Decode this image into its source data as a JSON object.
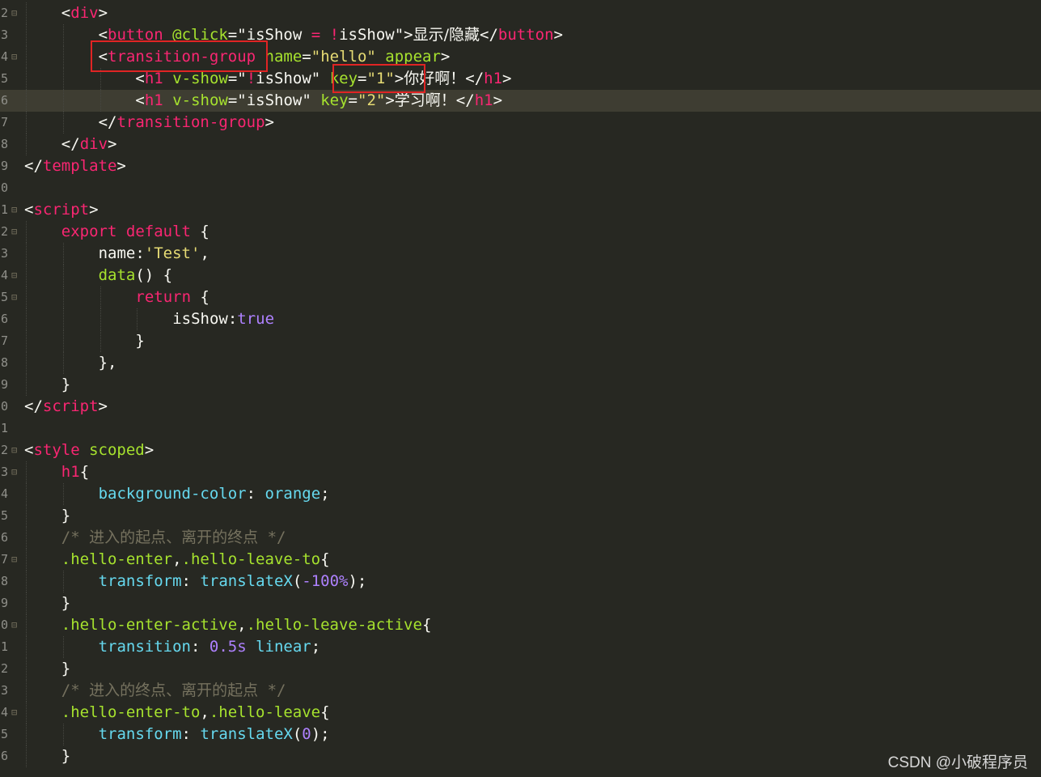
{
  "editor": {
    "theme_colors": {
      "background": "#272822",
      "current_line": "#3e3d32",
      "tag": "#f92672",
      "attribute": "#a6e22e",
      "string": "#e6db74",
      "property": "#66d9ef",
      "number": "#ae81ff",
      "comment": "#75715e",
      "highlight_box": "#e02424"
    },
    "lines": [
      {
        "num": "2",
        "fold": "⊟",
        "indent": 2,
        "tokens": [
          [
            "plain",
            "<"
          ],
          [
            "tag",
            "div"
          ],
          [
            "plain",
            ">"
          ]
        ]
      },
      {
        "num": "3",
        "fold": "",
        "indent": 4,
        "tokens": [
          [
            "plain",
            "<"
          ],
          [
            "tag",
            "button"
          ],
          [
            "plain",
            " "
          ],
          [
            "attr",
            "@click"
          ],
          [
            "plain",
            "=\"isShow "
          ],
          [
            "kw",
            "="
          ],
          [
            "plain",
            " "
          ],
          [
            "kw",
            "!"
          ],
          [
            "plain",
            "isShow\">"
          ],
          [
            "cjk",
            "显示/隐藏"
          ],
          [
            "plain",
            "</"
          ],
          [
            "tag",
            "button"
          ],
          [
            "plain",
            ">"
          ]
        ]
      },
      {
        "num": "4",
        "fold": "⊟",
        "indent": 4,
        "tokens": [
          [
            "plain",
            "<"
          ],
          [
            "tag",
            "transition-group"
          ],
          [
            "plain",
            " "
          ],
          [
            "attr",
            "name"
          ],
          [
            "plain",
            "="
          ],
          [
            "str",
            "\"hello\""
          ],
          [
            "plain",
            " "
          ],
          [
            "attr",
            "appear"
          ],
          [
            "plain",
            ">"
          ]
        ]
      },
      {
        "num": "5",
        "fold": "",
        "indent": 6,
        "tokens": [
          [
            "plain",
            "<"
          ],
          [
            "tag",
            "h1"
          ],
          [
            "plain",
            " "
          ],
          [
            "attr",
            "v-show"
          ],
          [
            "plain",
            "=\""
          ],
          [
            "kw",
            "!"
          ],
          [
            "plain",
            "isShow\" "
          ],
          [
            "attr",
            "key"
          ],
          [
            "plain",
            "="
          ],
          [
            "str",
            "\"1\""
          ],
          [
            "plain",
            ">"
          ],
          [
            "cjk",
            "你好啊！"
          ],
          [
            "plain",
            "</"
          ],
          [
            "tag",
            "h1"
          ],
          [
            "plain",
            ">"
          ]
        ]
      },
      {
        "num": "6",
        "fold": "",
        "indent": 6,
        "current": true,
        "tokens": [
          [
            "plain",
            "<"
          ],
          [
            "tag",
            "h1"
          ],
          [
            "plain",
            " "
          ],
          [
            "attr",
            "v-show"
          ],
          [
            "plain",
            "=\"isShow\" "
          ],
          [
            "attr",
            "key"
          ],
          [
            "plain",
            "="
          ],
          [
            "str",
            "\"2\""
          ],
          [
            "plain",
            ">"
          ],
          [
            "cjk",
            "学习啊！"
          ],
          [
            "plain",
            "</"
          ],
          [
            "tag",
            "h1"
          ],
          [
            "plain",
            ">"
          ]
        ]
      },
      {
        "num": "7",
        "fold": "",
        "indent": 4,
        "tokens": [
          [
            "plain",
            "</"
          ],
          [
            "tag",
            "transition-group"
          ],
          [
            "plain",
            ">"
          ]
        ]
      },
      {
        "num": "8",
        "fold": "",
        "indent": 2,
        "tokens": [
          [
            "plain",
            "</"
          ],
          [
            "tag",
            "div"
          ],
          [
            "plain",
            ">"
          ]
        ]
      },
      {
        "num": "9",
        "fold": "",
        "indent": 0,
        "tokens": [
          [
            "plain",
            "</"
          ],
          [
            "tag",
            "template"
          ],
          [
            "plain",
            ">"
          ]
        ]
      },
      {
        "num": "0",
        "fold": "",
        "indent": 0,
        "tokens": []
      },
      {
        "num": "1",
        "fold": "⊟",
        "indent": 0,
        "tokens": [
          [
            "plain",
            "<"
          ],
          [
            "tag",
            "script"
          ],
          [
            "plain",
            ">"
          ]
        ]
      },
      {
        "num": "2",
        "fold": "⊟",
        "indent": 2,
        "tokens": [
          [
            "kw",
            "export"
          ],
          [
            "plain",
            " "
          ],
          [
            "kw",
            "default"
          ],
          [
            "plain",
            " {"
          ]
        ]
      },
      {
        "num": "3",
        "fold": "",
        "indent": 4,
        "tokens": [
          [
            "plain",
            "name:"
          ],
          [
            "str",
            "'Test'"
          ],
          [
            "plain",
            ","
          ]
        ]
      },
      {
        "num": "4",
        "fold": "⊟",
        "indent": 4,
        "tokens": [
          [
            "fn",
            "data"
          ],
          [
            "plain",
            "() {"
          ]
        ]
      },
      {
        "num": "5",
        "fold": "⊟",
        "indent": 6,
        "tokens": [
          [
            "kw",
            "return"
          ],
          [
            "plain",
            " {"
          ]
        ]
      },
      {
        "num": "6",
        "fold": "",
        "indent": 8,
        "tokens": [
          [
            "plain",
            "isShow:"
          ],
          [
            "num",
            "true"
          ]
        ]
      },
      {
        "num": "7",
        "fold": "",
        "indent": 6,
        "tokens": [
          [
            "plain",
            "}"
          ]
        ]
      },
      {
        "num": "8",
        "fold": "",
        "indent": 4,
        "tokens": [
          [
            "plain",
            "},"
          ]
        ]
      },
      {
        "num": "9",
        "fold": "",
        "indent": 2,
        "tokens": [
          [
            "plain",
            "}"
          ]
        ]
      },
      {
        "num": "0",
        "fold": "",
        "indent": 0,
        "tokens": [
          [
            "plain",
            "</"
          ],
          [
            "tag",
            "script"
          ],
          [
            "plain",
            ">"
          ]
        ]
      },
      {
        "num": "1",
        "fold": "",
        "indent": 0,
        "tokens": []
      },
      {
        "num": "2",
        "fold": "⊟",
        "indent": 0,
        "tokens": [
          [
            "plain",
            "<"
          ],
          [
            "tag",
            "style"
          ],
          [
            "plain",
            " "
          ],
          [
            "attr",
            "scoped"
          ],
          [
            "plain",
            ">"
          ]
        ]
      },
      {
        "num": "3",
        "fold": "⊟",
        "indent": 2,
        "tokens": [
          [
            "tag",
            "h1"
          ],
          [
            "plain",
            "{"
          ]
        ]
      },
      {
        "num": "4",
        "fold": "",
        "indent": 4,
        "tokens": [
          [
            "prop",
            "background-color"
          ],
          [
            "plain",
            ": "
          ],
          [
            "prop",
            "orange"
          ],
          [
            "plain",
            ";"
          ]
        ]
      },
      {
        "num": "5",
        "fold": "",
        "indent": 2,
        "tokens": [
          [
            "plain",
            "}"
          ]
        ]
      },
      {
        "num": "6",
        "fold": "",
        "indent": 2,
        "tokens": [
          [
            "com",
            "/* "
          ],
          [
            "comcjk",
            "进入的起点、离开的终点"
          ],
          [
            "com",
            " */"
          ]
        ]
      },
      {
        "num": "7",
        "fold": "⊟",
        "indent": 2,
        "tokens": [
          [
            "sel",
            ".hello-enter"
          ],
          [
            "plain",
            ","
          ],
          [
            "sel",
            ".hello-leave-to"
          ],
          [
            "plain",
            "{"
          ]
        ]
      },
      {
        "num": "8",
        "fold": "",
        "indent": 4,
        "tokens": [
          [
            "prop",
            "transform"
          ],
          [
            "plain",
            ": "
          ],
          [
            "prop",
            "translateX"
          ],
          [
            "plain",
            "("
          ],
          [
            "num",
            "-100%"
          ],
          [
            "plain",
            ");"
          ]
        ]
      },
      {
        "num": "9",
        "fold": "",
        "indent": 2,
        "tokens": [
          [
            "plain",
            "}"
          ]
        ]
      },
      {
        "num": "0",
        "fold": "⊟",
        "indent": 2,
        "tokens": [
          [
            "sel",
            ".hello-enter-active"
          ],
          [
            "plain",
            ","
          ],
          [
            "sel",
            ".hello-leave-active"
          ],
          [
            "plain",
            "{"
          ]
        ]
      },
      {
        "num": "1",
        "fold": "",
        "indent": 4,
        "tokens": [
          [
            "prop",
            "transition"
          ],
          [
            "plain",
            ": "
          ],
          [
            "num",
            "0.5s"
          ],
          [
            "plain",
            " "
          ],
          [
            "prop",
            "linear"
          ],
          [
            "plain",
            ";"
          ]
        ]
      },
      {
        "num": "2",
        "fold": "",
        "indent": 2,
        "tokens": [
          [
            "plain",
            "}"
          ]
        ]
      },
      {
        "num": "3",
        "fold": "",
        "indent": 2,
        "tokens": [
          [
            "com",
            "/* "
          ],
          [
            "comcjk",
            "进入的终点、离开的起点"
          ],
          [
            "com",
            " */"
          ]
        ]
      },
      {
        "num": "4",
        "fold": "⊟",
        "indent": 2,
        "tokens": [
          [
            "sel",
            ".hello-enter-to"
          ],
          [
            "plain",
            ","
          ],
          [
            "sel",
            ".hello-leave"
          ],
          [
            "plain",
            "{"
          ]
        ]
      },
      {
        "num": "5",
        "fold": "",
        "indent": 4,
        "tokens": [
          [
            "prop",
            "transform"
          ],
          [
            "plain",
            ": "
          ],
          [
            "prop",
            "translateX"
          ],
          [
            "plain",
            "("
          ],
          [
            "num",
            "0"
          ],
          [
            "plain",
            ");"
          ]
        ]
      },
      {
        "num": "6",
        "fold": "",
        "indent": 2,
        "tokens": [
          [
            "plain",
            "}"
          ]
        ]
      }
    ]
  },
  "watermark": "CSDN @小破程序员"
}
